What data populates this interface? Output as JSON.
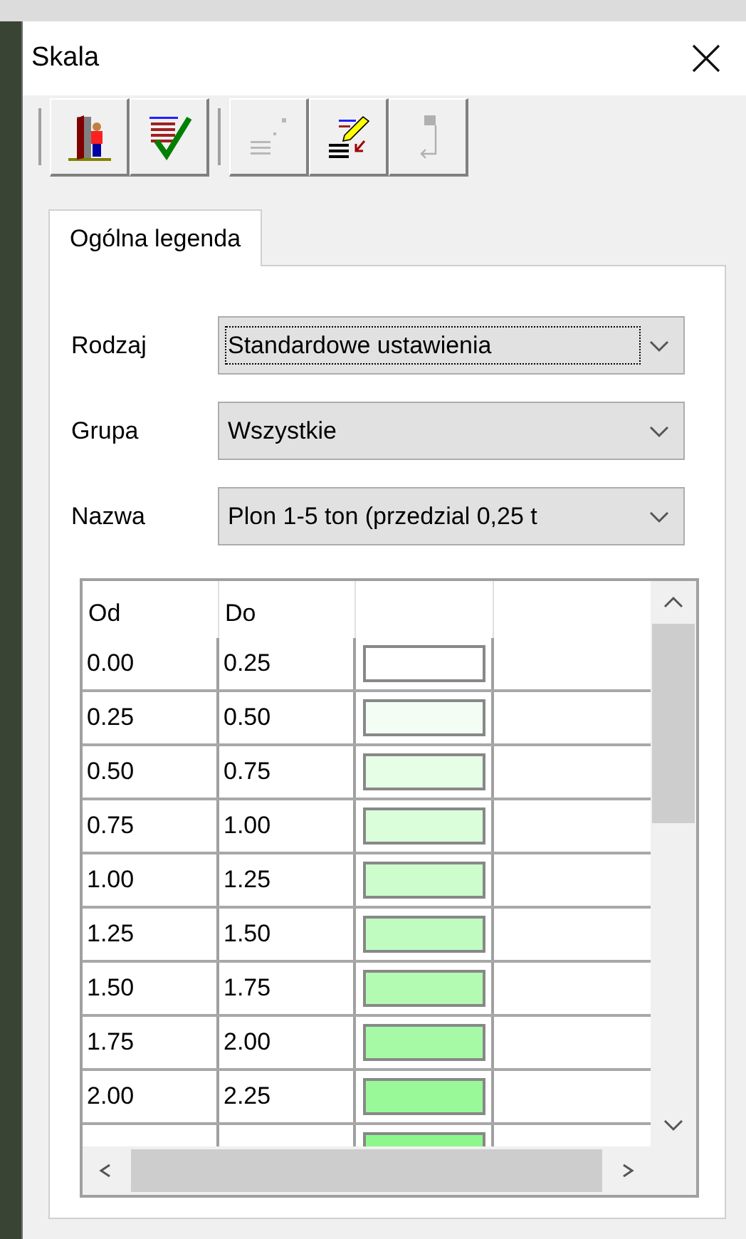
{
  "window": {
    "title": "Skala"
  },
  "toolbar": [
    {
      "kind": "exit",
      "disabled": false
    },
    {
      "kind": "apply",
      "disabled": false
    },
    {
      "kind": "grid",
      "disabled": true
    },
    {
      "kind": "edit",
      "disabled": false
    },
    {
      "kind": "copy",
      "disabled": true
    }
  ],
  "tabs": [
    {
      "label": "Ogólna legenda",
      "selected": true
    }
  ],
  "fields": [
    {
      "label": "Rodzaj",
      "value": "Standardowe ustawienia",
      "focused": true
    },
    {
      "label": "Grupa",
      "value": "Wszystkie",
      "focused": false
    },
    {
      "label": "Nazwa",
      "value": "Plon 1-5 ton (przedzial 0,25 t",
      "focused": false
    }
  ],
  "table": {
    "columns": [
      "Od",
      "Do"
    ],
    "rows": [
      {
        "from": "0.00",
        "to": "0.25",
        "color": "#ffffff"
      },
      {
        "from": "0.25",
        "to": "0.50",
        "color": "#f3fdf3"
      },
      {
        "from": "0.50",
        "to": "0.75",
        "color": "#e6fde6"
      },
      {
        "from": "0.75",
        "to": "1.00",
        "color": "#dafeda"
      },
      {
        "from": "1.00",
        "to": "1.25",
        "color": "#cdfdcd"
      },
      {
        "from": "1.25",
        "to": "1.50",
        "color": "#c0fcc0"
      },
      {
        "from": "1.50",
        "to": "1.75",
        "color": "#b3fbb3"
      },
      {
        "from": "1.75",
        "to": "2.00",
        "color": "#a6faa6"
      },
      {
        "from": "2.00",
        "to": "2.25",
        "color": "#99f999"
      },
      {
        "color": "#8cf88c"
      }
    ]
  }
}
